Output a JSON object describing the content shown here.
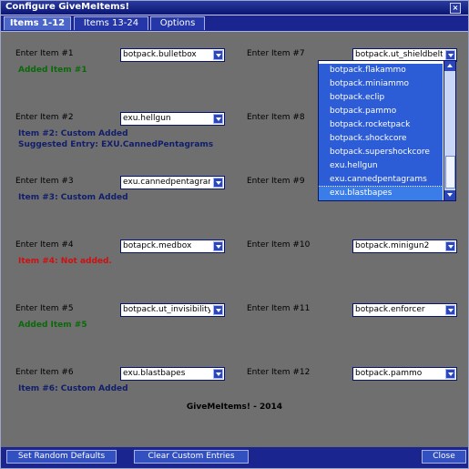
{
  "window": {
    "title": "Configure GiveMeItems!"
  },
  "tabs": [
    {
      "label": "Items 1-12"
    },
    {
      "label": "Items 13-24"
    },
    {
      "label": "Options"
    }
  ],
  "items": [
    {
      "label": "Enter Item #1",
      "value": "botpack.bulletbox"
    },
    {
      "label": "Enter Item #2",
      "value": "exu.hellgun"
    },
    {
      "label": "Enter Item #3",
      "value": "exu.cannedpentagrams"
    },
    {
      "label": "Enter Item #4",
      "value": "botapck.medbox"
    },
    {
      "label": "Enter Item #5",
      "value": "botpack.ut_invisibility"
    },
    {
      "label": "Enter Item #6",
      "value": "exu.blastbapes"
    },
    {
      "label": "Enter Item #7",
      "value": "botpack.ut_shieldbelt"
    },
    {
      "label": "Enter Item #8",
      "value": ""
    },
    {
      "label": "Enter Item #9",
      "value": ""
    },
    {
      "label": "Enter Item #10",
      "value": "botpack.minigun2"
    },
    {
      "label": "Enter Item #11",
      "value": "botpack.enforcer"
    },
    {
      "label": "Enter Item #12",
      "value": "botpack.pammo"
    }
  ],
  "statuses": [
    {
      "lines": [
        "Added Item #1"
      ],
      "color": "#0a6a0a"
    },
    {
      "lines": [
        "Item #2: Custom Added",
        "Suggested Entry: EXU.CannedPentagrams"
      ],
      "color": "#101e6c"
    },
    {
      "lines": [
        "Item #3: Custom Added"
      ],
      "color": "#101e6c"
    },
    {
      "lines": [
        "Item #4: Not added."
      ],
      "color": "#d01010"
    },
    {
      "lines": [
        "Added Item #5"
      ],
      "color": "#0a6a0a"
    },
    {
      "lines": [
        "Item #6: Custom Added"
      ],
      "color": "#101e6c"
    }
  ],
  "dropdown": {
    "options": [
      "botpack.flakammo",
      "botpack.miniammo",
      "botpack.eclip",
      "botpack.pammo",
      "botpack.rocketpack",
      "botpack.shockcore",
      "botpack.supershockcore",
      "exu.hellgun",
      "exu.cannedpentagrams",
      "exu.blastbapes"
    ],
    "selected": "exu.blastbapes"
  },
  "credit": "GiveMeItems! - 2014",
  "footer": {
    "random_defaults": "Set Random Defaults",
    "clear_custom": "Clear Custom Entries",
    "close": "Close"
  }
}
